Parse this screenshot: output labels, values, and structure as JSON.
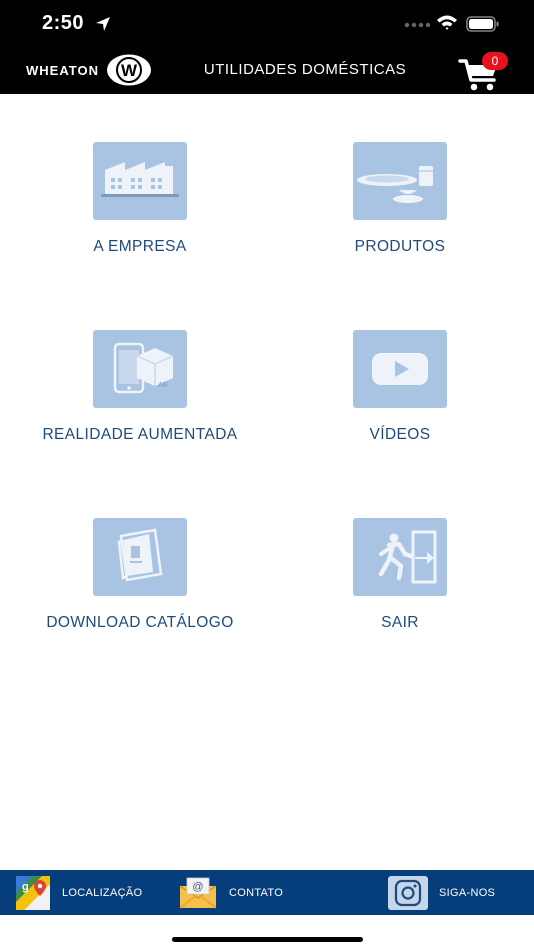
{
  "status": {
    "time": "2:50"
  },
  "nav": {
    "brand": "WHEATON",
    "brand_logo_letter": "W",
    "title": "UTILIDADES DOMÉSTICAS",
    "cart_count": "0"
  },
  "menu": {
    "items": [
      {
        "label": "A EMPRESA",
        "icon": "factory-icon"
      },
      {
        "label": "PRODUTOS",
        "icon": "tableware-icon"
      },
      {
        "label": "REALIDADE AUMENTADA",
        "icon": "augmented-reality-icon",
        "badge": "AR"
      },
      {
        "label": "VÍDEOS",
        "icon": "play-video-icon"
      },
      {
        "label": "DOWNLOAD CATÁLOGO",
        "icon": "catalog-icon"
      },
      {
        "label": "SAIR",
        "icon": "exit-door-icon"
      }
    ]
  },
  "bottom": {
    "location_label": "LOCALIZAÇÃO",
    "contact_label": "CONTATO",
    "contact_icon_symbol": "@",
    "follow_label": "SIGA-NOS"
  },
  "colors": {
    "bar_black": "#000000",
    "tile_bg": "#a9c3e3",
    "label_blue": "#1e4b7c",
    "bottom_bar": "#053e7a",
    "badge_red": "#e8121c"
  }
}
